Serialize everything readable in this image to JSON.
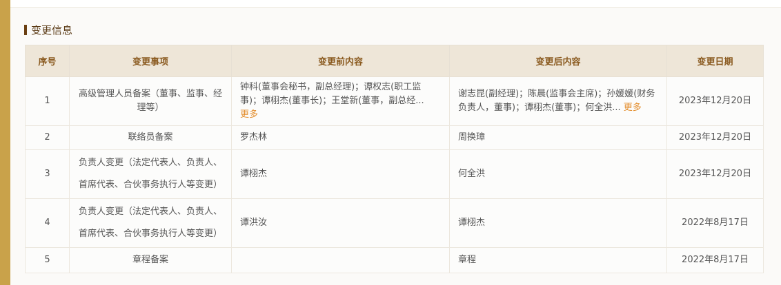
{
  "section": {
    "title": "变更信息"
  },
  "table": {
    "headers": [
      "序号",
      "变更事项",
      "变更前内容",
      "变更后内容",
      "变更日期"
    ],
    "more_label": "更多",
    "rows": [
      {
        "index": "1",
        "item": "高级管理人员备案（董事、监事、经理等）",
        "before": "钟科(董事会秘书，副总经理)；谭权志(职工监事)；谭栩杰(董事长)；王堂新(董事，副总经...",
        "after": "谢志昆(副经理)；陈晨(监事会主席)；孙媛媛(财务负责人，董事)；谭栩杰(董事)；何全洪...",
        "date": "2023年12月20日"
      },
      {
        "index": "2",
        "item": "联络员备案",
        "before": "罗杰林",
        "after": "周换璋",
        "date": "2023年12月20日"
      },
      {
        "index": "3",
        "item": "负责人变更（法定代表人、负责人、首席代表、合伙事务执行人等变更）",
        "before": "谭栩杰",
        "after": "何全洪",
        "date": "2023年12月20日"
      },
      {
        "index": "4",
        "item": "负责人变更（法定代表人、负责人、首席代表、合伙事务执行人等变更）",
        "before": "谭洪汝",
        "after": "谭栩杰",
        "date": "2022年8月17日"
      },
      {
        "index": "5",
        "item": "章程备案",
        "before": "",
        "after": "章程",
        "date": "2022年8月17日"
      }
    ]
  }
}
